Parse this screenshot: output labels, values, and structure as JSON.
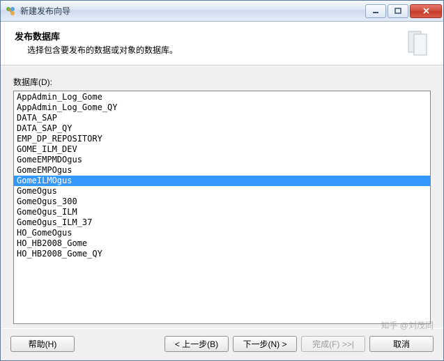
{
  "window": {
    "title": "新建发布向导"
  },
  "header": {
    "title": "发布数据库",
    "subtitle": "选择包含要发布的数据或对象的数据库。"
  },
  "field": {
    "label": "数据库(D):"
  },
  "databases": [
    {
      "name": "AppAdmin_Log_Gome",
      "selected": false
    },
    {
      "name": "AppAdmin_Log_Gome_QY",
      "selected": false
    },
    {
      "name": "DATA_SAP",
      "selected": false
    },
    {
      "name": "DATA_SAP_QY",
      "selected": false
    },
    {
      "name": "EMP_DP_REPOSITORY",
      "selected": false
    },
    {
      "name": "GOME_ILM_DEV",
      "selected": false
    },
    {
      "name": "GomeEMPMDOgus",
      "selected": false
    },
    {
      "name": "GomeEMPOgus",
      "selected": false
    },
    {
      "name": "GomeILMOgus",
      "selected": true
    },
    {
      "name": "GomeOgus",
      "selected": false
    },
    {
      "name": "GomeOgus_300",
      "selected": false
    },
    {
      "name": "GomeOgus_ILM",
      "selected": false
    },
    {
      "name": "GomeOgus_ILM_37",
      "selected": false
    },
    {
      "name": "HO_GomeOgus",
      "selected": false
    },
    {
      "name": "HO_HB2008_Gome",
      "selected": false
    },
    {
      "name": "HO_HB2008_Gome_QY",
      "selected": false
    }
  ],
  "buttons": {
    "help": "帮助(H)",
    "back": "< 上一步(B)",
    "next": "下一步(N) >",
    "finish": "完成(F) >>|",
    "cancel": "取消"
  },
  "watermark": "知乎 @刘茂同"
}
